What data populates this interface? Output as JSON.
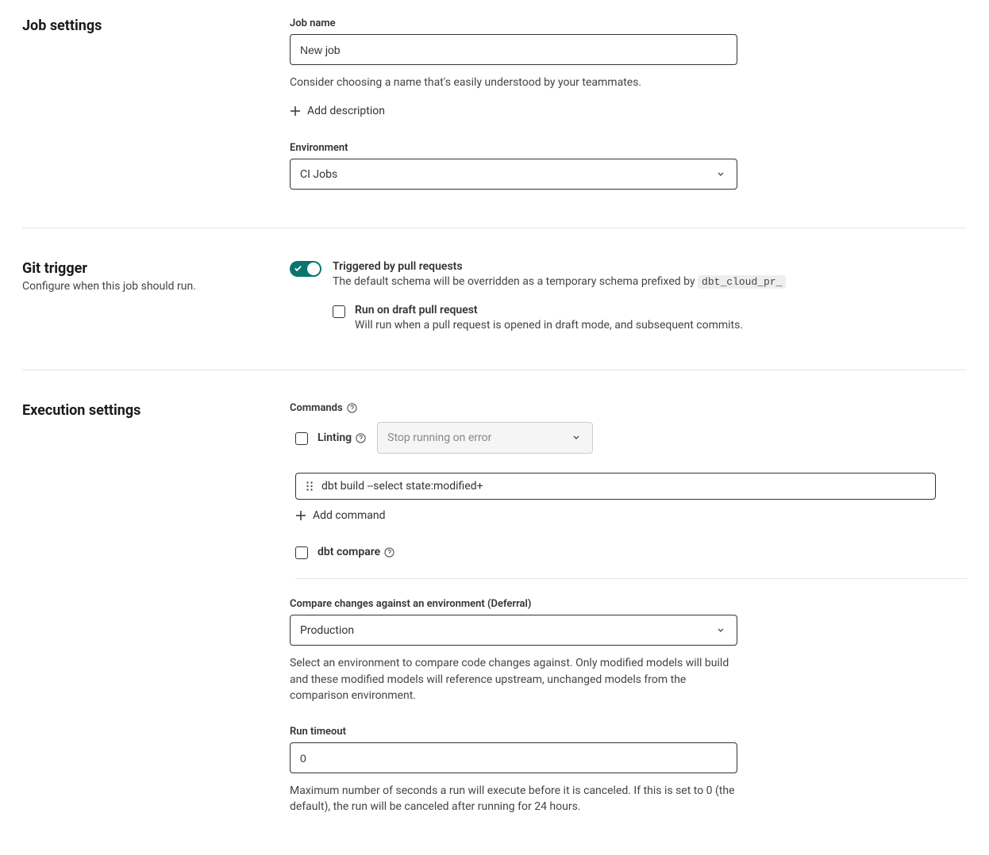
{
  "job_settings": {
    "title": "Job settings",
    "job_name_label": "Job name",
    "job_name_value": "New job",
    "job_name_helper": "Consider choosing a name that's easily understood by your teammates.",
    "add_description": "Add description",
    "environment_label": "Environment",
    "environment_value": "CI Jobs"
  },
  "git_trigger": {
    "title": "Git trigger",
    "subtitle": "Configure when this job should run.",
    "triggered_label": "Triggered by pull requests",
    "triggered_desc_prefix": "The default schema will be overridden as a temporary schema prefixed by ",
    "triggered_desc_code": "dbt_cloud_pr_",
    "run_draft_label": "Run on draft pull request",
    "run_draft_desc": "Will run when a pull request is opened in draft mode, and subsequent commits."
  },
  "execution": {
    "title": "Execution settings",
    "commands_label": "Commands",
    "linting_label": "Linting",
    "linting_select": "Stop running on error",
    "command_value": "dbt build --select state:modified+",
    "add_command": "Add command",
    "dbt_compare_label": "dbt compare",
    "deferral_label": "Compare changes against an environment (Deferral)",
    "deferral_value": "Production",
    "deferral_helper": "Select an environment to compare code changes against. Only modified models will build and these modified models will reference upstream, unchanged models from the comparison environment.",
    "timeout_label": "Run timeout",
    "timeout_value": "0",
    "timeout_helper": "Maximum number of seconds a run will execute before it is canceled. If this is set to 0 (the default), the run will be canceled after running for 24 hours."
  }
}
